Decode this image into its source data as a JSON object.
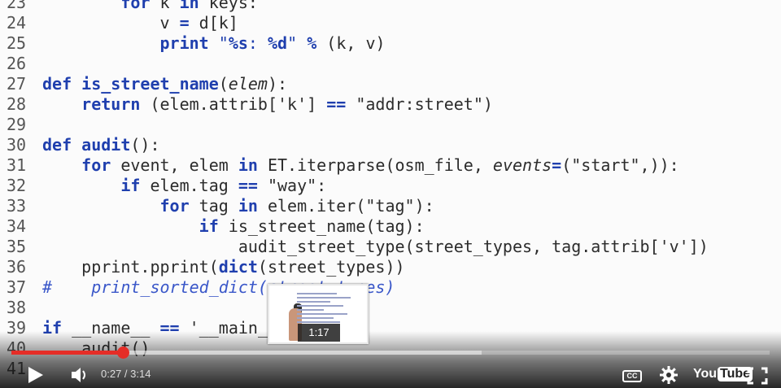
{
  "code_lines": [
    {
      "n": "23",
      "html": "        <span class='kw'>for</span> k <span class='kw'>in</span> keys:"
    },
    {
      "n": "24",
      "html": "            v <span class='op'>=</span> d[k]"
    },
    {
      "n": "25",
      "html": "            <span class='kw'>print</span> <span class='strb'>\"<span class='fmt'>%s</span>: <span class='fmt'>%d</span>\"</span> <span class='op'>%</span> (k, v)"
    },
    {
      "n": "26",
      "html": ""
    },
    {
      "n": "27",
      "html": "<span class='kw'>def</span> <span class='fn'>is_street_name</span>(<span class='it'>elem</span>):"
    },
    {
      "n": "28",
      "html": "    <span class='kw'>return</span> (elem.attrib['k'] <span class='op'>==</span> \"addr:street\")"
    },
    {
      "n": "29",
      "html": ""
    },
    {
      "n": "30",
      "html": "<span class='kw'>def</span> <span class='fn'>audit</span>():"
    },
    {
      "n": "31",
      "html": "    <span class='kw'>for</span> event, elem <span class='kw'>in</span> ET.iterparse(osm_file, <span class='it'>events</span><span class='op'>=</span>(\"start\",)):"
    },
    {
      "n": "32",
      "html": "        <span class='kw'>if</span> elem.tag <span class='op'>==</span> \"way\":"
    },
    {
      "n": "33",
      "html": "            <span class='kw'>for</span> tag <span class='kw'>in</span> elem.iter(\"tag\"):"
    },
    {
      "n": "34",
      "html": "                <span class='kw'>if</span> is_street_name(tag):"
    },
    {
      "n": "35",
      "html": "                    audit_street_type(street_types, tag.attrib['v'])"
    },
    {
      "n": "36",
      "html": "    pprint.pprint(<span class='kw'>dict</span>(street_types))"
    },
    {
      "n": "37",
      "html": "<span class='cm'>#    print_sorted_dict(street_types)</span>"
    },
    {
      "n": "38",
      "html": ""
    },
    {
      "n": "39",
      "html": "<span class='kw'>if</span> __name__ <span class='op'>==</span> '__main__':"
    },
    {
      "n": "40",
      "html": "    audit()"
    },
    {
      "n": "41",
      "html": ""
    }
  ],
  "player": {
    "preview_time": "1:17",
    "current_time": "0:27",
    "duration": "3:14",
    "time_display": "0:27 / 3:14",
    "played_fraction": 0.147,
    "loaded_fraction": 0.62,
    "cc_label": "CC",
    "logo_you": "You",
    "logo_tube": "Tube"
  },
  "colors": {
    "progress_played": "#e52d27",
    "keyword": "#1f3fae"
  },
  "icons": [
    "play-icon",
    "volume-icon",
    "settings-gear-icon",
    "fullscreen-icon",
    "youtube-logo"
  ]
}
